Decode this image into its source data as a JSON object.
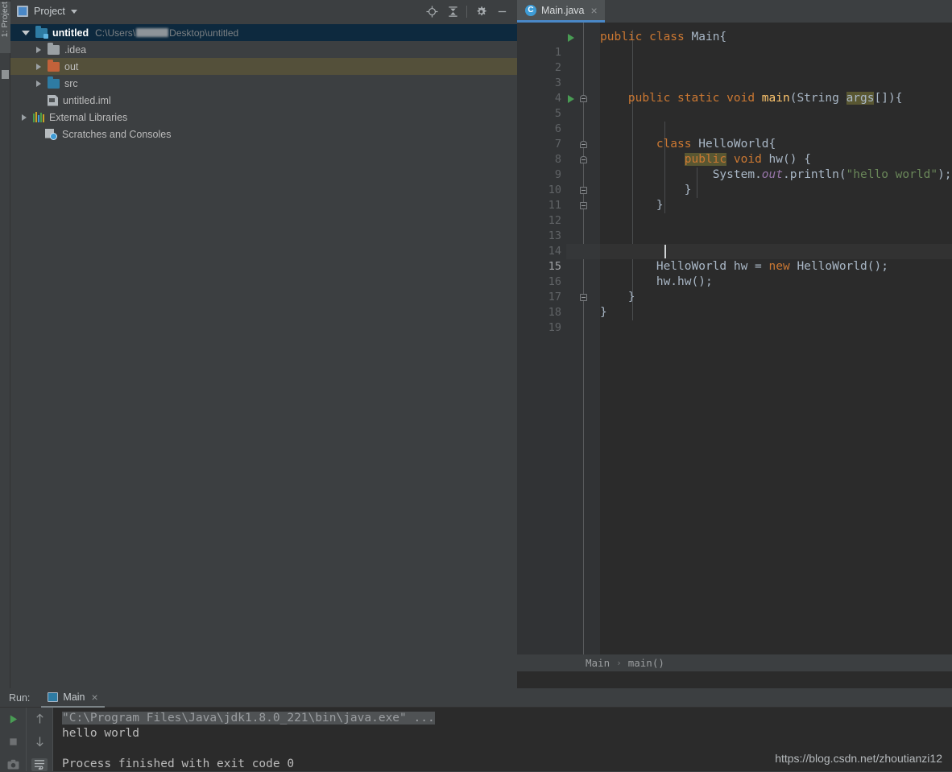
{
  "left_strip": {
    "project_button_label": "1: Project"
  },
  "project_panel": {
    "title": "Project",
    "title_icon": "project-window-icon",
    "tools": [
      {
        "name": "locate-icon",
        "label": "Select Opened File"
      },
      {
        "name": "collapse-all-icon",
        "label": "Collapse All"
      },
      {
        "name": "gear-icon",
        "label": "Settings"
      },
      {
        "name": "minimize-icon",
        "label": "Hide"
      }
    ],
    "tree": [
      {
        "label": "untitled",
        "path_prefix": "C:\\Users\\",
        "path_suffix": "Desktop\\untitled",
        "icon": "module-folder-icon",
        "state": "expanded",
        "depth": 0,
        "selected": true,
        "bold": true
      },
      {
        "label": ".idea",
        "icon": "folder-grey-icon",
        "state": "collapsed",
        "depth": 1,
        "selected": false,
        "bold": false
      },
      {
        "label": "out",
        "icon": "folder-orange-icon",
        "state": "collapsed",
        "depth": 1,
        "selected": false,
        "excluded": true,
        "bold": false
      },
      {
        "label": "src",
        "icon": "folder-blue-icon",
        "state": "collapsed",
        "depth": 1,
        "selected": false,
        "bold": false
      },
      {
        "label": "untitled.iml",
        "icon": "iml-file-icon",
        "state": "leaf",
        "depth": 1,
        "selected": false,
        "bold": false
      },
      {
        "label": "External Libraries",
        "icon": "external-libraries-icon",
        "state": "collapsed",
        "depth": 0,
        "selected": false,
        "bold": false
      },
      {
        "label": "Scratches and Consoles",
        "icon": "scratches-icon",
        "state": "leaf",
        "depth": 0,
        "selected": false,
        "bold": false
      }
    ]
  },
  "editor": {
    "tab": {
      "label": "Main.java",
      "icon": "java-class-icon",
      "close": "×"
    },
    "current_line": 15,
    "lines": [
      {
        "n": 1,
        "indent": 0,
        "run_marker": true,
        "fold": null,
        "tokens": [
          {
            "t": "public ",
            "c": "kw"
          },
          {
            "t": "class ",
            "c": "kw"
          },
          {
            "t": "Main{",
            "c": "id"
          }
        ]
      },
      {
        "n": 2,
        "indent": 0,
        "run_marker": false,
        "fold": null,
        "tokens": []
      },
      {
        "n": 3,
        "indent": 0,
        "run_marker": false,
        "fold": null,
        "tokens": []
      },
      {
        "n": 4,
        "indent": 0,
        "run_marker": false,
        "fold": null,
        "tokens": []
      },
      {
        "n": 5,
        "indent": 0,
        "run_marker": true,
        "fold": "open",
        "tokens": [
          {
            "t": "    ",
            "c": "id"
          },
          {
            "t": "public ",
            "c": "kw"
          },
          {
            "t": "static ",
            "c": "kw"
          },
          {
            "t": "void ",
            "c": "kw"
          },
          {
            "t": "main",
            "c": "fn"
          },
          {
            "t": "(",
            "c": "id"
          },
          {
            "t": "String ",
            "c": "id"
          },
          {
            "t": "args",
            "c": "hl"
          },
          {
            "t": "[]){",
            "c": "id"
          }
        ]
      },
      {
        "n": 6,
        "indent": 0,
        "run_marker": false,
        "fold": null,
        "tokens": []
      },
      {
        "n": 7,
        "indent": 0,
        "run_marker": false,
        "fold": null,
        "tokens": []
      },
      {
        "n": 8,
        "indent": 0,
        "run_marker": false,
        "fold": "open",
        "tokens": [
          {
            "t": "        ",
            "c": "id"
          },
          {
            "t": "class ",
            "c": "kw"
          },
          {
            "t": "HelloWorld{",
            "c": "id"
          }
        ]
      },
      {
        "n": 9,
        "indent": 0,
        "run_marker": false,
        "fold": "open",
        "tokens": [
          {
            "t": "            ",
            "c": "id"
          },
          {
            "t": "public",
            "c": "kw hl"
          },
          {
            "t": " ",
            "c": "id"
          },
          {
            "t": "void ",
            "c": "kw"
          },
          {
            "t": "hw",
            "c": "id"
          },
          {
            "t": "() {",
            "c": "id"
          }
        ]
      },
      {
        "n": 10,
        "indent": 0,
        "run_marker": false,
        "fold": null,
        "tokens": [
          {
            "t": "                ",
            "c": "id"
          },
          {
            "t": "System",
            "c": "id"
          },
          {
            "t": ".",
            "c": "id"
          },
          {
            "t": "out",
            "c": "stat"
          },
          {
            "t": ".println(",
            "c": "id"
          },
          {
            "t": "\"hello world\"",
            "c": "str"
          },
          {
            "t": ");",
            "c": "id"
          }
        ]
      },
      {
        "n": 11,
        "indent": 0,
        "run_marker": false,
        "fold": "close",
        "tokens": [
          {
            "t": "            }",
            "c": "id"
          }
        ]
      },
      {
        "n": 12,
        "indent": 0,
        "run_marker": false,
        "fold": "close",
        "tokens": [
          {
            "t": "        }",
            "c": "id"
          }
        ]
      },
      {
        "n": 13,
        "indent": 0,
        "run_marker": false,
        "fold": null,
        "tokens": []
      },
      {
        "n": 14,
        "indent": 0,
        "run_marker": false,
        "fold": null,
        "tokens": []
      },
      {
        "n": 15,
        "indent": 0,
        "run_marker": false,
        "fold": null,
        "tokens": [],
        "caret": true
      },
      {
        "n": 16,
        "indent": 0,
        "run_marker": false,
        "fold": null,
        "tokens": [
          {
            "t": "        ",
            "c": "id"
          },
          {
            "t": "HelloWorld hw = ",
            "c": "id"
          },
          {
            "t": "new ",
            "c": "kw"
          },
          {
            "t": "HelloWorld();",
            "c": "id"
          }
        ]
      },
      {
        "n": 17,
        "indent": 0,
        "run_marker": false,
        "fold": null,
        "tokens": [
          {
            "t": "        ",
            "c": "id"
          },
          {
            "t": "hw.hw();",
            "c": "id"
          }
        ]
      },
      {
        "n": 18,
        "indent": 0,
        "run_marker": false,
        "fold": "close",
        "tokens": [
          {
            "t": "    }",
            "c": "id"
          }
        ]
      },
      {
        "n": 19,
        "indent": 0,
        "run_marker": false,
        "fold": null,
        "tokens": [
          {
            "t": "}",
            "c": "id"
          }
        ]
      }
    ],
    "breadcrumb": {
      "items": [
        "Main",
        "main()"
      ],
      "separator": "›"
    }
  },
  "run_panel": {
    "label": "Run:",
    "tab": {
      "label": "Main",
      "icon": "run-config-icon",
      "close": "×"
    },
    "buttons": [
      {
        "name": "rerun-button",
        "icon": "play-icon"
      },
      {
        "name": "stop-button",
        "icon": "stop-icon"
      },
      {
        "name": "screenshot-button",
        "icon": "camera-icon"
      },
      {
        "name": "scroll-up-button",
        "icon": "arrow-up-icon"
      },
      {
        "name": "scroll-down-button",
        "icon": "arrow-down-icon"
      },
      {
        "name": "soft-wrap-button",
        "icon": "soft-wrap-icon"
      }
    ],
    "console_lines": [
      {
        "text": "\"C:\\Program Files\\Java\\jdk1.8.0_221\\bin\\java.exe\" ...",
        "highlighted": true
      },
      {
        "text": "hello world",
        "highlighted": false
      },
      {
        "text": "",
        "highlighted": false
      },
      {
        "text": "Process finished with exit code 0",
        "highlighted": false
      }
    ]
  },
  "watermark": "https://blog.csdn.net/zhoutianzi12",
  "colors": {
    "bg_chrome": "#3c3f41",
    "bg_editor": "#2b2b2b",
    "gutter": "#313335",
    "accent_tab": "#4a88c7",
    "selection": "#0d293e",
    "excluded": "#54503a",
    "keyword": "#cc7832",
    "string": "#6a8759",
    "method": "#ffc66d",
    "static_field": "#9876aa",
    "identifier": "#a9b7c6",
    "search_highlight": "#595732",
    "run_green": "#499c54"
  }
}
